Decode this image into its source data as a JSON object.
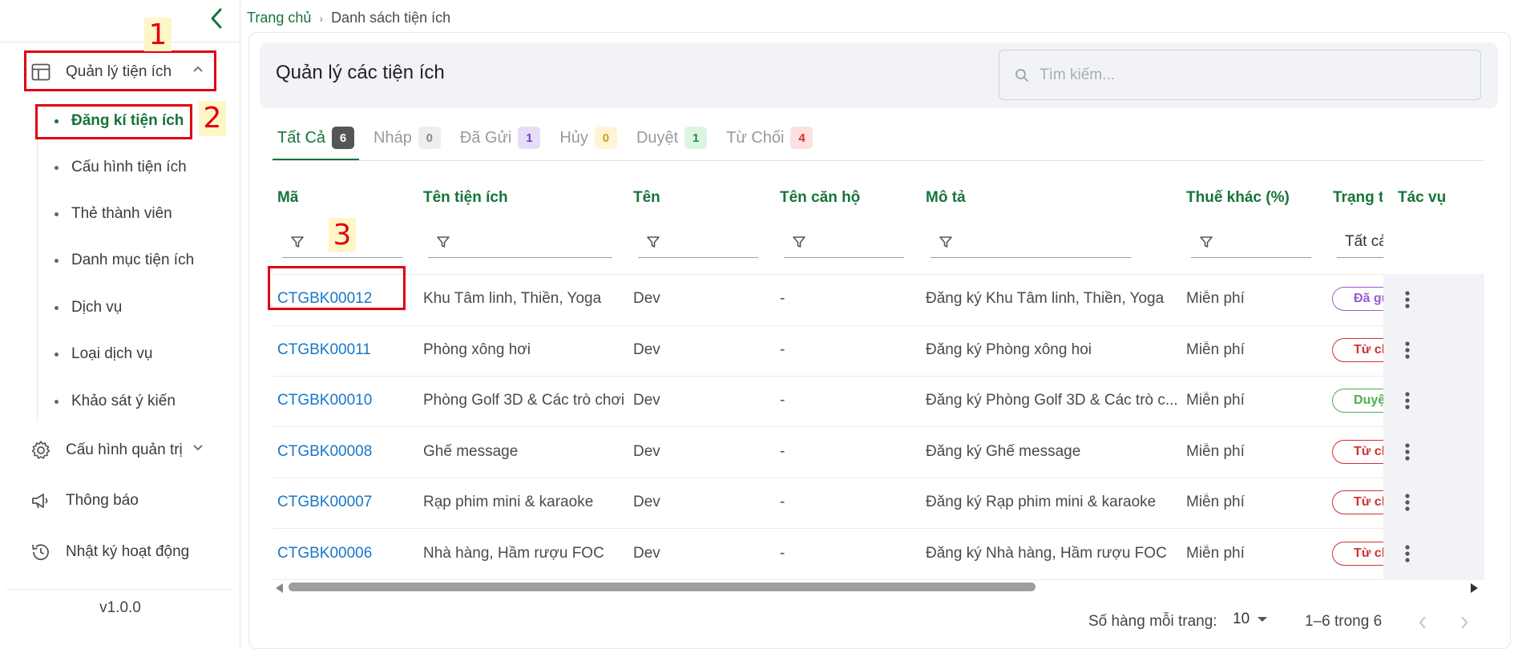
{
  "sidebar": {
    "menu": [
      {
        "label": "Quản lý tiện ích",
        "icon": "layout-icon"
      },
      {
        "label": "Cấu hình quản trị",
        "icon": "gear-icon"
      },
      {
        "label": "Thông báo",
        "icon": "megaphone-icon"
      },
      {
        "label": "Nhật ký hoạt động",
        "icon": "history-icon"
      }
    ],
    "submenu": [
      {
        "label": "Đăng kí tiện ích",
        "active": true
      },
      {
        "label": "Cấu hình tiện ích"
      },
      {
        "label": "Thẻ thành viên"
      },
      {
        "label": "Danh mục tiện ích"
      },
      {
        "label": "Dịch vụ"
      },
      {
        "label": "Loại dịch vụ"
      },
      {
        "label": "Khảo sát ý kiến"
      }
    ],
    "version": "v1.0.0"
  },
  "annotations": [
    "1",
    "2",
    "3"
  ],
  "breadcrumb": {
    "home": "Trang chủ",
    "current": "Danh sách tiện ích"
  },
  "page": {
    "title": "Quản lý các tiện ích"
  },
  "search": {
    "placeholder": "Tìm kiếm..."
  },
  "tabs": [
    {
      "label": "Tất Cả",
      "count": "6",
      "active": true,
      "badge_bg": "#555555",
      "badge_fg": "#ffffff"
    },
    {
      "label": "Nháp",
      "count": "0",
      "badge_bg": "#eeeeee",
      "badge_fg": "#888888"
    },
    {
      "label": "Đã Gửi",
      "count": "1",
      "badge_bg": "#e6def8",
      "badge_fg": "#6a45b8"
    },
    {
      "label": "Hủy",
      "count": "0",
      "badge_bg": "#fff5d6",
      "badge_fg": "#c9a21a"
    },
    {
      "label": "Duyệt",
      "count": "1",
      "badge_bg": "#dcf5e3",
      "badge_fg": "#1f8a3d"
    },
    {
      "label": "Từ Chối",
      "count": "4",
      "badge_bg": "#fde0e0",
      "badge_fg": "#d32f2f"
    }
  ],
  "table": {
    "columns": [
      "Mã",
      "Tên tiện ích",
      "Tên",
      "Tên căn hộ",
      "Mô tả",
      "Thuế khác (%)",
      "Trạng thái",
      "Tác vụ"
    ],
    "status_filter": "Tất cả",
    "rows": [
      {
        "code": "CTGBK00012",
        "name": "Khu Tâm linh, Thiền, Yoga",
        "owner": "Dev",
        "apartment": "-",
        "desc": "Đăng ký Khu Tâm linh, Thiền, Yoga",
        "tax": "Miễn phí",
        "status": "Đã gửi",
        "status_color": "#9c5ad6"
      },
      {
        "code": "CTGBK00011",
        "name": "Phòng xông hơi",
        "owner": "Dev",
        "apartment": "-",
        "desc": "Đăng ký Phòng xông hoi",
        "tax": "Miễn phí",
        "status": "Từ chối",
        "status_color": "#d32f2f"
      },
      {
        "code": "CTGBK00010",
        "name": "Phòng Golf 3D & Các trò chơi",
        "owner": "Dev",
        "apartment": "-",
        "desc": "Đăng ký Phòng Golf 3D & Các trò c...",
        "tax": "Miễn phí",
        "status": "Duyệt",
        "status_color": "#4caf50"
      },
      {
        "code": "CTGBK00008",
        "name": "Ghế message",
        "owner": "Dev",
        "apartment": "-",
        "desc": "Đăng ký Ghế message",
        "tax": "Miễn phí",
        "status": "Từ chối",
        "status_color": "#d32f2f"
      },
      {
        "code": "CTGBK00007",
        "name": "Rạp phim mini & karaoke",
        "owner": "Dev",
        "apartment": "-",
        "desc": "Đăng ký Rạp phim mini & karaoke",
        "tax": "Miễn phí",
        "status": "Từ chối",
        "status_color": "#d32f2f"
      },
      {
        "code": "CTGBK00006",
        "name": "Nhà hàng, Hầm rượu FOC",
        "owner": "Dev",
        "apartment": "-",
        "desc": "Đăng ký Nhà hàng, Hầm rượu FOC",
        "tax": "Miễn phí",
        "status": "Từ chối",
        "status_color": "#d32f2f"
      }
    ]
  },
  "pagination": {
    "rows_label": "Số hàng mỗi trang:",
    "rows_value": "10",
    "range": "1–6 trong 6"
  },
  "colors": {
    "primary": "#16743a",
    "link": "#1877c8",
    "annotation": "#e0000f"
  }
}
